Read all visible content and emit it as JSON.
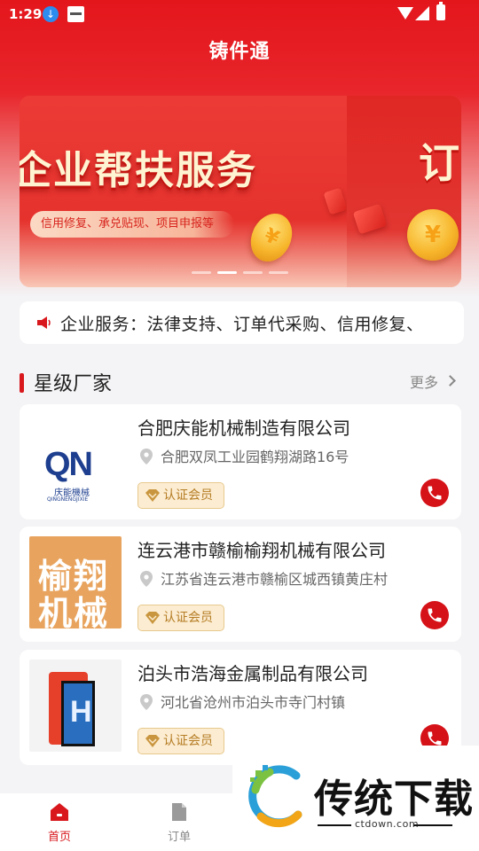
{
  "status_bar": {
    "time": "1:29"
  },
  "app": {
    "title": "铸件通"
  },
  "banner": {
    "headline": "企业帮扶服务",
    "subtitle": "信用修复、承兑贴现、项目申报等",
    "next_slide_char": "订",
    "slide_count": 4,
    "active_slide": 2
  },
  "notice": {
    "text": "企业服务：法律支持、订单代采购、信用修复、"
  },
  "section": {
    "title": "星级厂家",
    "more_label": "更多"
  },
  "companies": [
    {
      "name": "合肥庆能机械制造有限公司",
      "address": "合肥双凤工业园鹤翔湖路16号",
      "badge": "认证会员",
      "logo_text": "QN",
      "logo_sub": "庆能機械",
      "logo_pinyin": "QINGNENGJIXIE"
    },
    {
      "name": "连云港市赣榆榆翔机械有限公司",
      "address": "江苏省连云港市赣榆区城西镇黄庄村",
      "badge": "认证会员",
      "logo_line1": "榆翔",
      "logo_line2": "机械"
    },
    {
      "name": "泊头市浩海金属制品有限公司",
      "address": "河北省沧州市泊头市寺门村镇",
      "badge": "认证会员"
    }
  ],
  "bottom_nav": [
    {
      "label": "首页",
      "active": true
    },
    {
      "label": "订单",
      "active": false
    }
  ],
  "watermark": {
    "text": "传统下载",
    "url": "ctdown.com"
  },
  "colors": {
    "brand_red": "#d8181c",
    "badge_bg": "#fcecd1",
    "badge_text": "#b57d25"
  }
}
